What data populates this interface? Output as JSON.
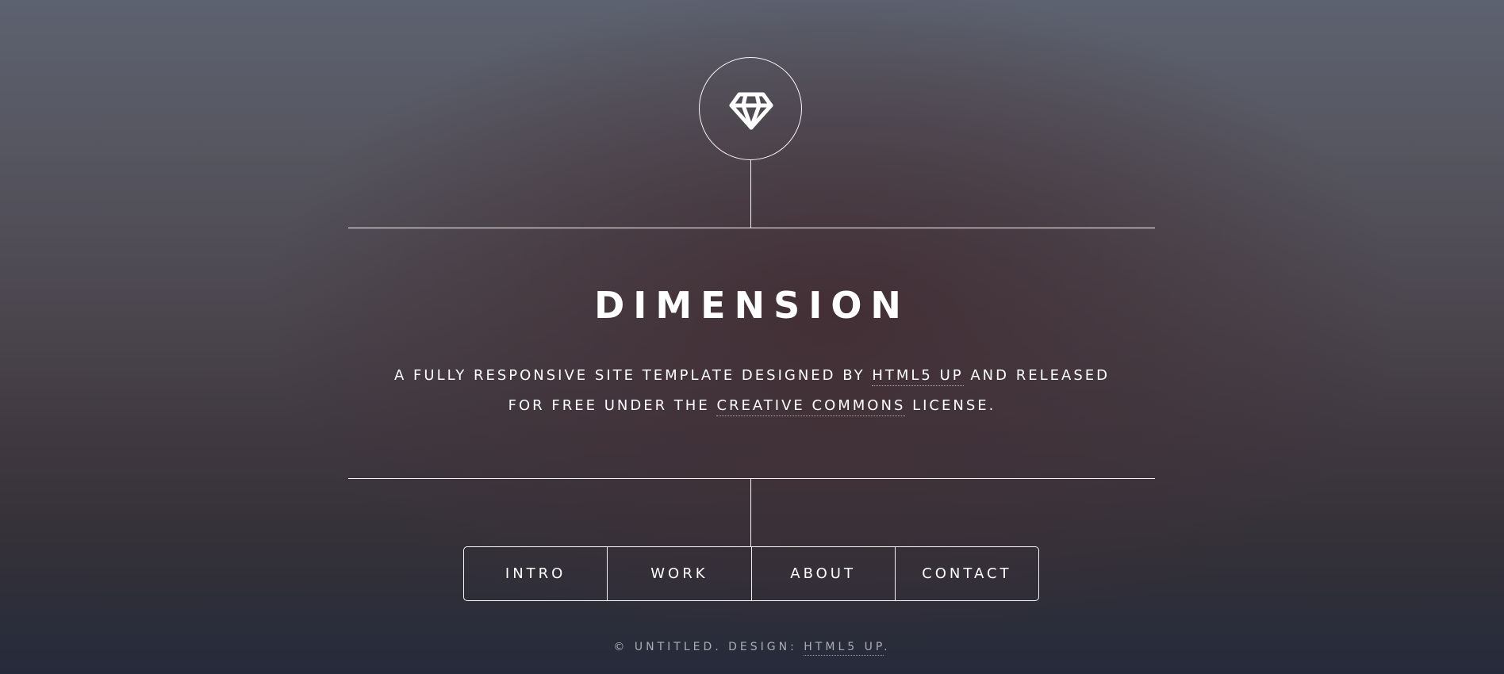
{
  "header": {
    "logo_icon": "diamond-icon",
    "title": "DIMENSION",
    "tagline": {
      "line1_prefix": "A FULLY RESPONSIVE SITE TEMPLATE DESIGNED BY ",
      "line1_link": "HTML5 UP",
      "line1_suffix": " AND RELEASED",
      "line2_prefix": "FOR FREE UNDER THE ",
      "line2_link": "CREATIVE COMMONS",
      "line2_suffix": " LICENSE."
    }
  },
  "nav": {
    "items": [
      {
        "label": "INTRO"
      },
      {
        "label": "WORK"
      },
      {
        "label": "ABOUT"
      },
      {
        "label": "CONTACT"
      }
    ]
  },
  "footer": {
    "prefix": "© UNTITLED. DESIGN: ",
    "link": "HTML5 UP",
    "suffix": "."
  },
  "colors": {
    "text": "#ffffff",
    "background_top": "#5d6270",
    "background_center": "#422e34",
    "background_bottom": "#262b3b"
  }
}
